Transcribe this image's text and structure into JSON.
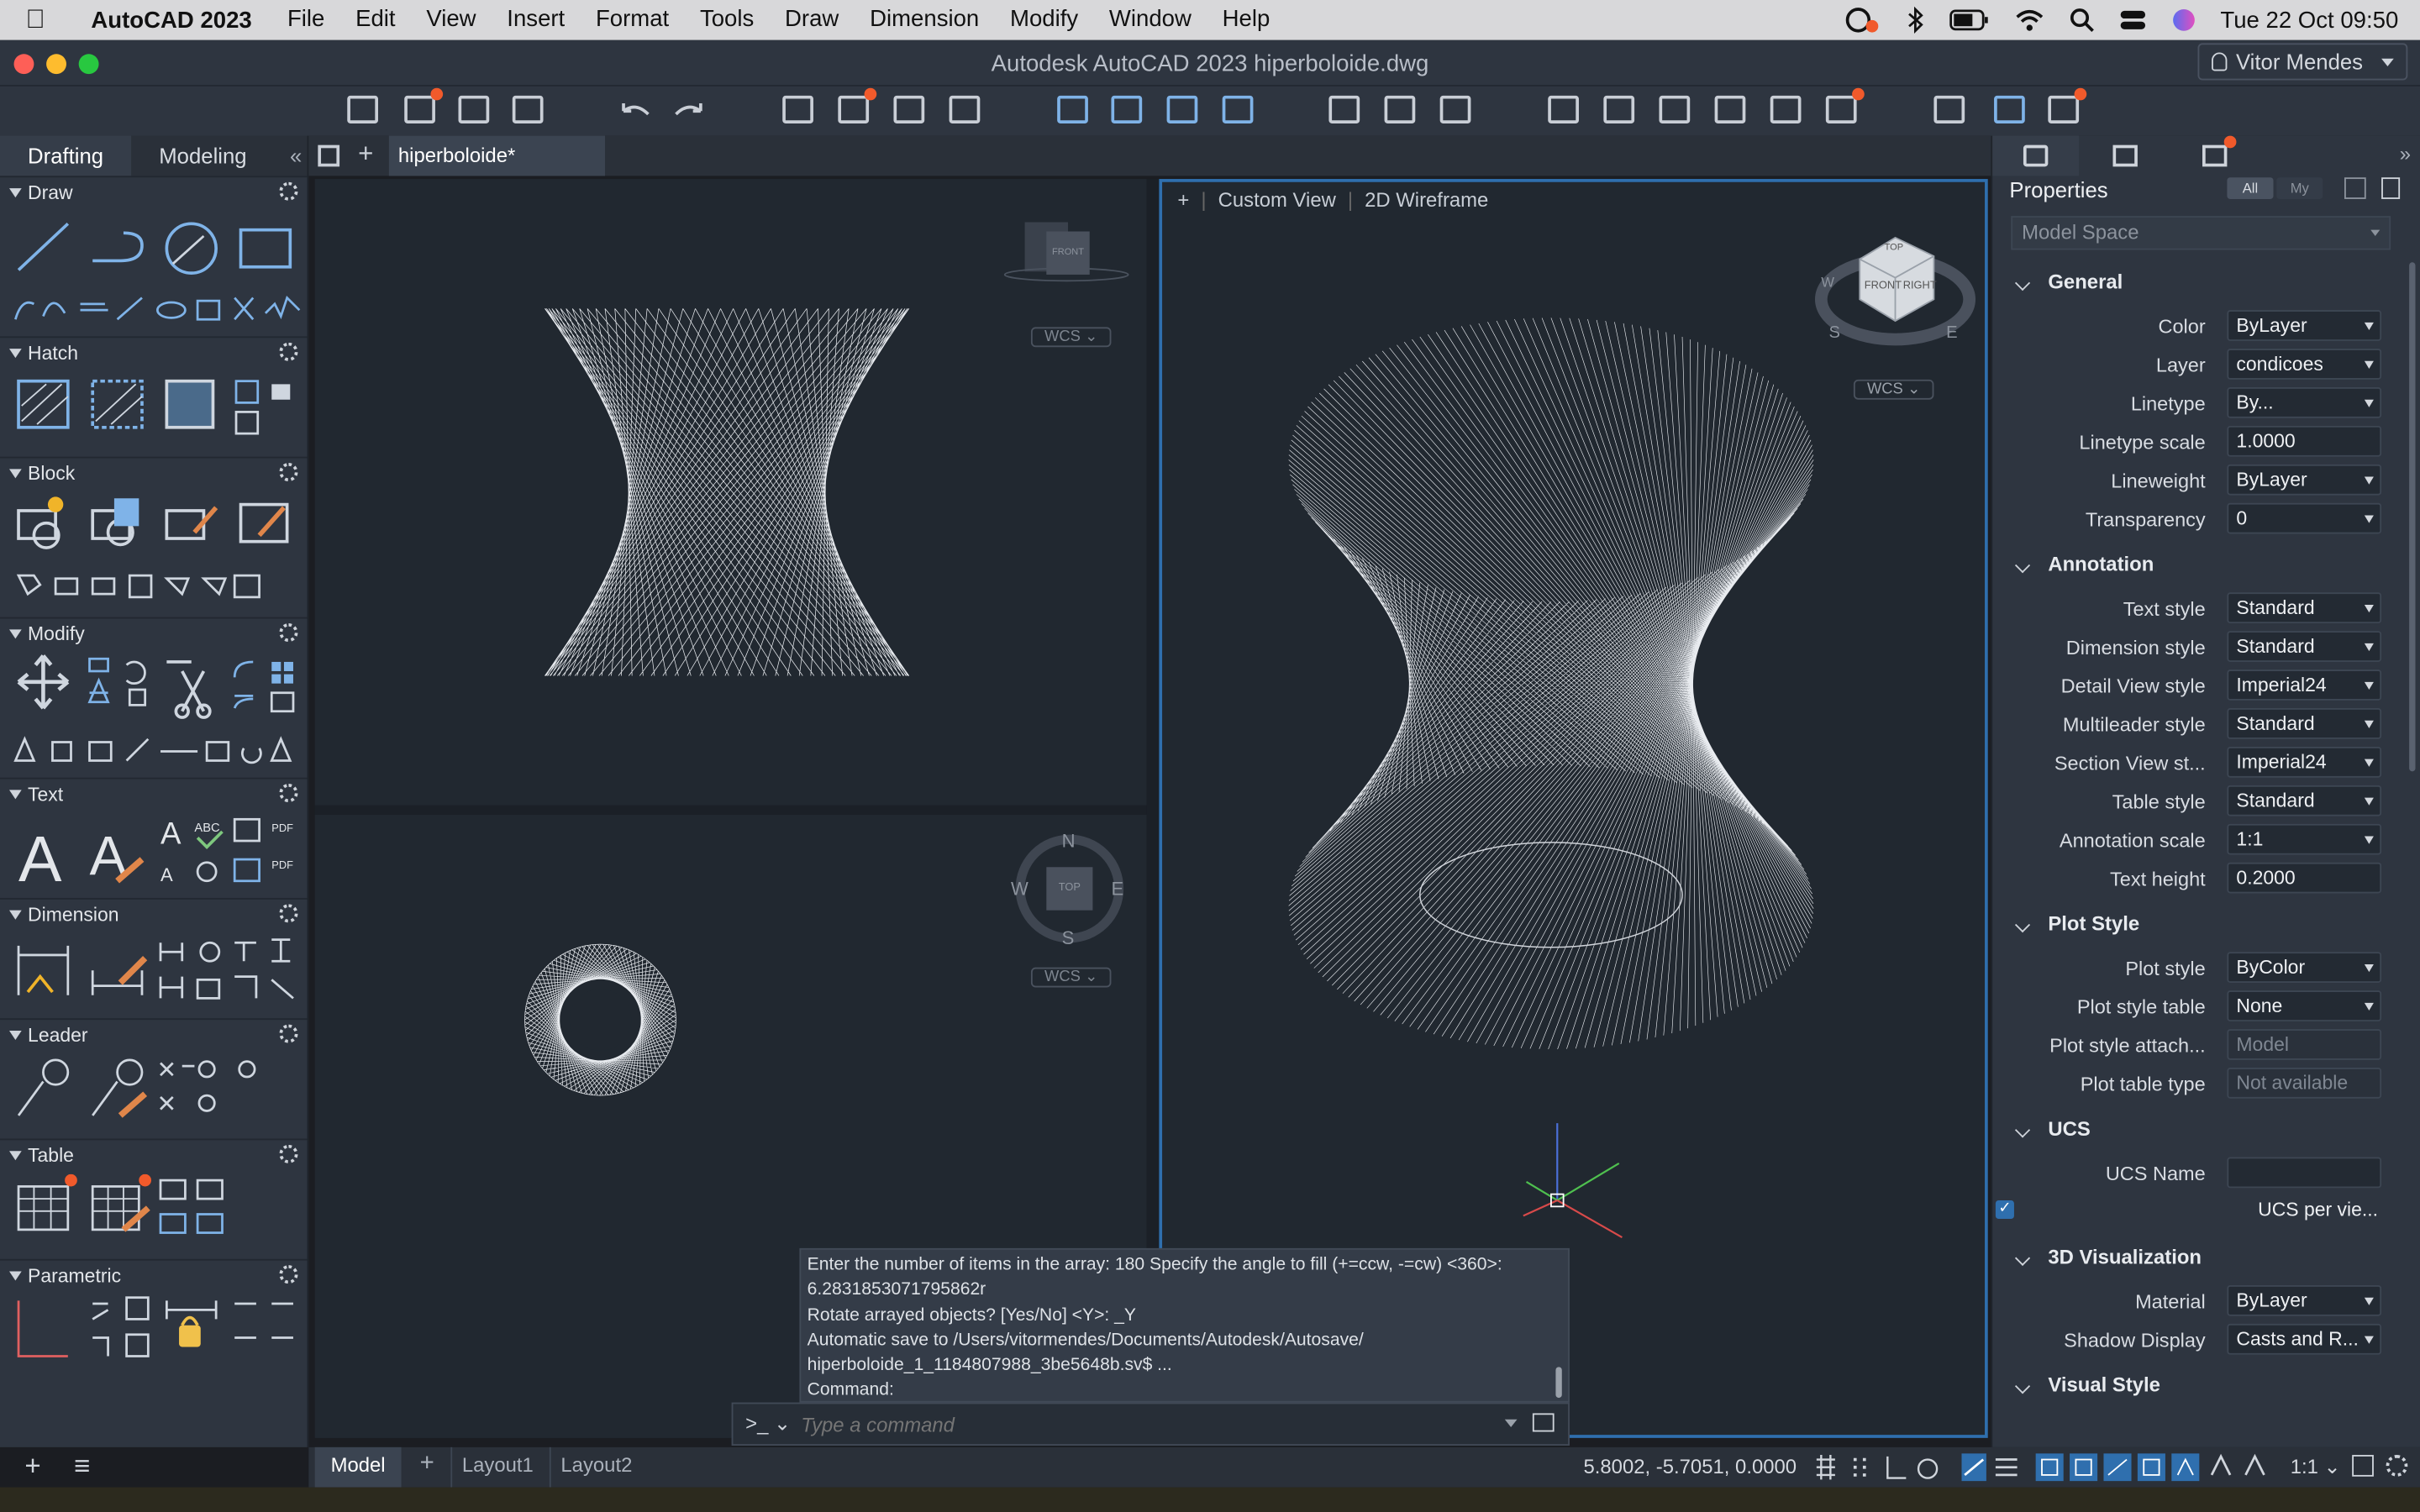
{
  "menubar": {
    "app_name": "AutoCAD 2023",
    "items": [
      "File",
      "Edit",
      "View",
      "Insert",
      "Format",
      "Tools",
      "Draw",
      "Dimension",
      "Modify",
      "Window",
      "Help"
    ],
    "clock": "Tue 22 Oct  09:50"
  },
  "window": {
    "title": "Autodesk AutoCAD 2023    hiperboloide.dwg",
    "user": "Vitor Mendes"
  },
  "palette": {
    "tabs": [
      "Drafting",
      "Modeling"
    ],
    "active_tab": "Drafting",
    "sections": [
      "Draw",
      "Hatch",
      "Block",
      "Modify",
      "Text",
      "Dimension",
      "Leader",
      "Table",
      "Parametric"
    ]
  },
  "doc_tab": "hiperboloide*",
  "viewports": {
    "top_left": {
      "view_cube_label": "FRONT",
      "ucs": "WCS"
    },
    "bottom_left": {
      "ucs": "WCS",
      "compass": {
        "n": "N",
        "s": "S",
        "e": "E",
        "w": "W",
        "face": "TOP"
      }
    },
    "right": {
      "controls": [
        "+",
        "Custom View",
        "2D Wireframe"
      ],
      "ucs": "WCS",
      "cube_faces": [
        "TOP",
        "FRONT",
        "RIGHT"
      ],
      "compass": {
        "s": "S",
        "e": "E",
        "w": "W"
      }
    }
  },
  "command_line": {
    "history": [
      "Enter the number of items in the array: 180 Specify the angle to fill (+=ccw, -=cw) <360>:",
      "6.2831853071795862r",
      "Rotate arrayed objects? [Yes/No] <Y>: _Y",
      "Automatic save to /Users/vitormendes/Documents/Autodesk/Autosave/",
      "hiperboloide_1_1184807988_3be5648b.sv$ ...",
      "Command:"
    ],
    "prompt": ">_",
    "placeholder": "Type a command"
  },
  "properties": {
    "title": "Properties",
    "filters": [
      "All",
      "My"
    ],
    "selection": "Model Space",
    "categories": [
      {
        "name": "General",
        "rows": [
          {
            "label": "Color",
            "value": "ByLayer"
          },
          {
            "label": "Layer",
            "value": "condicoes"
          },
          {
            "label": "Linetype",
            "value": "By..."
          },
          {
            "label": "Linetype scale",
            "value": "1.0000"
          },
          {
            "label": "Lineweight",
            "value": "ByLayer"
          },
          {
            "label": "Transparency",
            "value": "0"
          }
        ]
      },
      {
        "name": "Annotation",
        "rows": [
          {
            "label": "Text style",
            "value": "Standard"
          },
          {
            "label": "Dimension style",
            "value": "Standard"
          },
          {
            "label": "Detail View style",
            "value": "Imperial24"
          },
          {
            "label": "Multileader style",
            "value": "Standard"
          },
          {
            "label": "Section View st...",
            "value": "Imperial24"
          },
          {
            "label": "Table style",
            "value": "Standard"
          },
          {
            "label": "Annotation scale",
            "value": "1:1"
          },
          {
            "label": "Text height",
            "value": "0.2000"
          }
        ]
      },
      {
        "name": "Plot Style",
        "rows": [
          {
            "label": "Plot style",
            "value": "ByColor"
          },
          {
            "label": "Plot style table",
            "value": "None"
          },
          {
            "label": "Plot style attach...",
            "value": "Model"
          },
          {
            "label": "Plot table type",
            "value": "Not available"
          }
        ]
      },
      {
        "name": "UCS",
        "rows": [
          {
            "label": "UCS Name",
            "value": ""
          },
          {
            "label": "",
            "value": "UCS per vie..."
          }
        ]
      },
      {
        "name": "3D Visualization",
        "rows": [
          {
            "label": "Material",
            "value": "ByLayer"
          },
          {
            "label": "Shadow Display",
            "value": "Casts and R..."
          }
        ]
      },
      {
        "name": "Visual Style",
        "rows": []
      }
    ]
  },
  "status": {
    "layout_tabs": [
      "Model",
      "Layout1",
      "Layout2"
    ],
    "active_layout": "Model",
    "coordinates": "5.8002,  -5.7051, 0.0000",
    "annotation_scale": "1:1"
  },
  "colors": {
    "accent_blue": "#2f6fae",
    "notification_dot": "#f15a2b",
    "canvas": "#212830",
    "panel": "#2e3540"
  }
}
